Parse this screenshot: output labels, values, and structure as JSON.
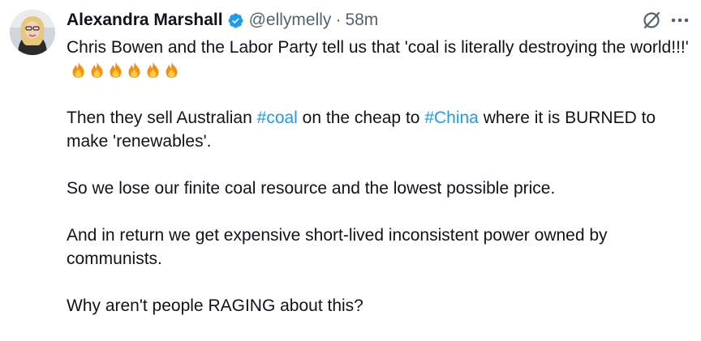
{
  "author": {
    "display_name": "Alexandra Marshall",
    "handle": "@ellymelly",
    "separator": "·",
    "time": "58m",
    "verified_icon": "verified-badge-icon",
    "avatar_icon": "profile-avatar"
  },
  "actions": {
    "grok_icon": "grok-icon",
    "more_icon": "more-options-icon"
  },
  "tweet": {
    "p1": {
      "text": "Chris Bowen and the Labor Party tell us that 'coal is literally destroying the world!!!'",
      "emoji": "fire-icon",
      "emoji_count": 6
    },
    "p2": {
      "before": "Then they sell Australian ",
      "tag1": "#coal",
      "middle": " on the cheap to ",
      "tag2": "#China",
      "after": " where it is BURNED to make 'renewables'."
    },
    "p3": "So we lose our finite coal resource and the lowest possible price.",
    "p4": "And in return we get expensive short-lived inconsistent power owned by communists.",
    "p5": "Why aren't people RAGING about this?"
  },
  "colors": {
    "text": "#0f1419",
    "secondary": "#536471",
    "link": "#1d9bf0",
    "verified": "#1d9bf0"
  }
}
